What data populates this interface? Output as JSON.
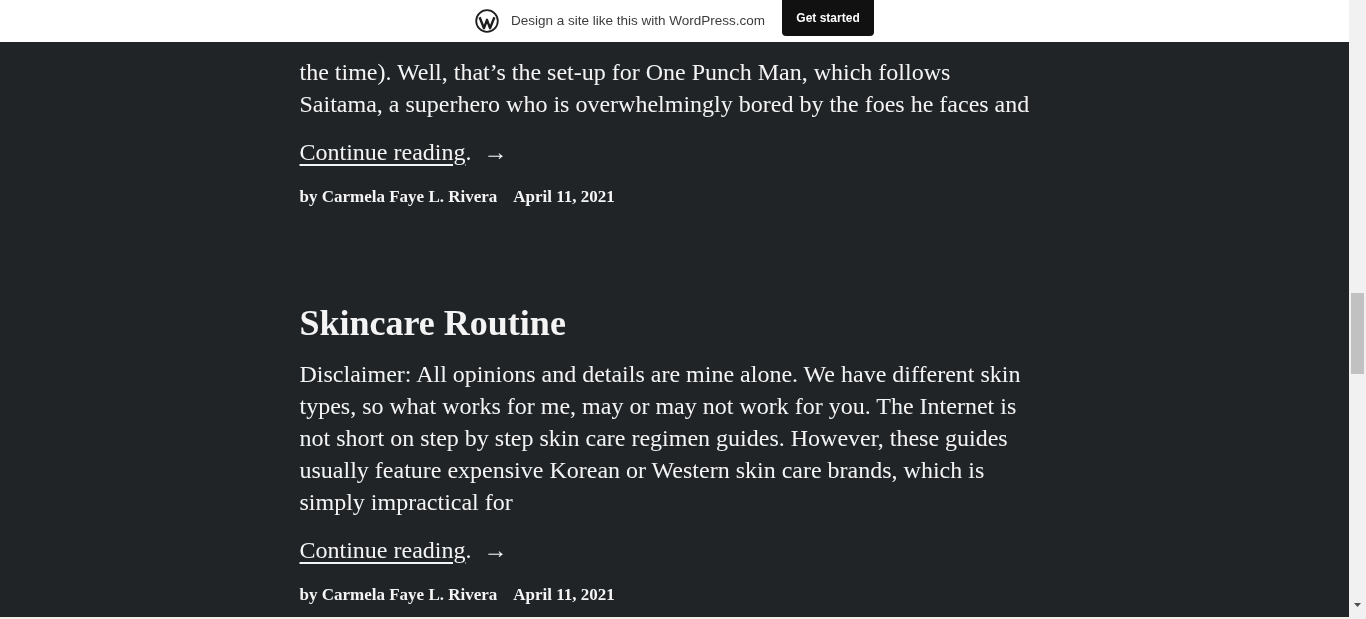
{
  "banner": {
    "text": "Design a site like this with WordPress.com",
    "button": "Get started"
  },
  "posts": [
    {
      "excerpt": "the time). Well, that’s the set-up for One Punch Man, which follows Saitama, a superhero who is overwhelmingly bored by the foes he faces and",
      "more": {
        "label": "Continue reading",
        "end": ".",
        "arrow": "→"
      },
      "author": "by Carmela Faye L. Rivera",
      "date": "April 11, 2021"
    },
    {
      "title": "Skincare Routine",
      "excerpt": "Disclaimer: All opinions and details are mine alone. We have different skin types, so what works for me, may or may not work for you. The Internet is not short on step by step skin care regimen guides. However, these guides usually feature expensive Korean or Western skin care brands, which is simply impractical for",
      "more": {
        "label": "Continue reading",
        "end": ".",
        "arrow": "→"
      },
      "author": "by Carmela Faye L. Rivera",
      "date": "April 11, 2021"
    }
  ]
}
